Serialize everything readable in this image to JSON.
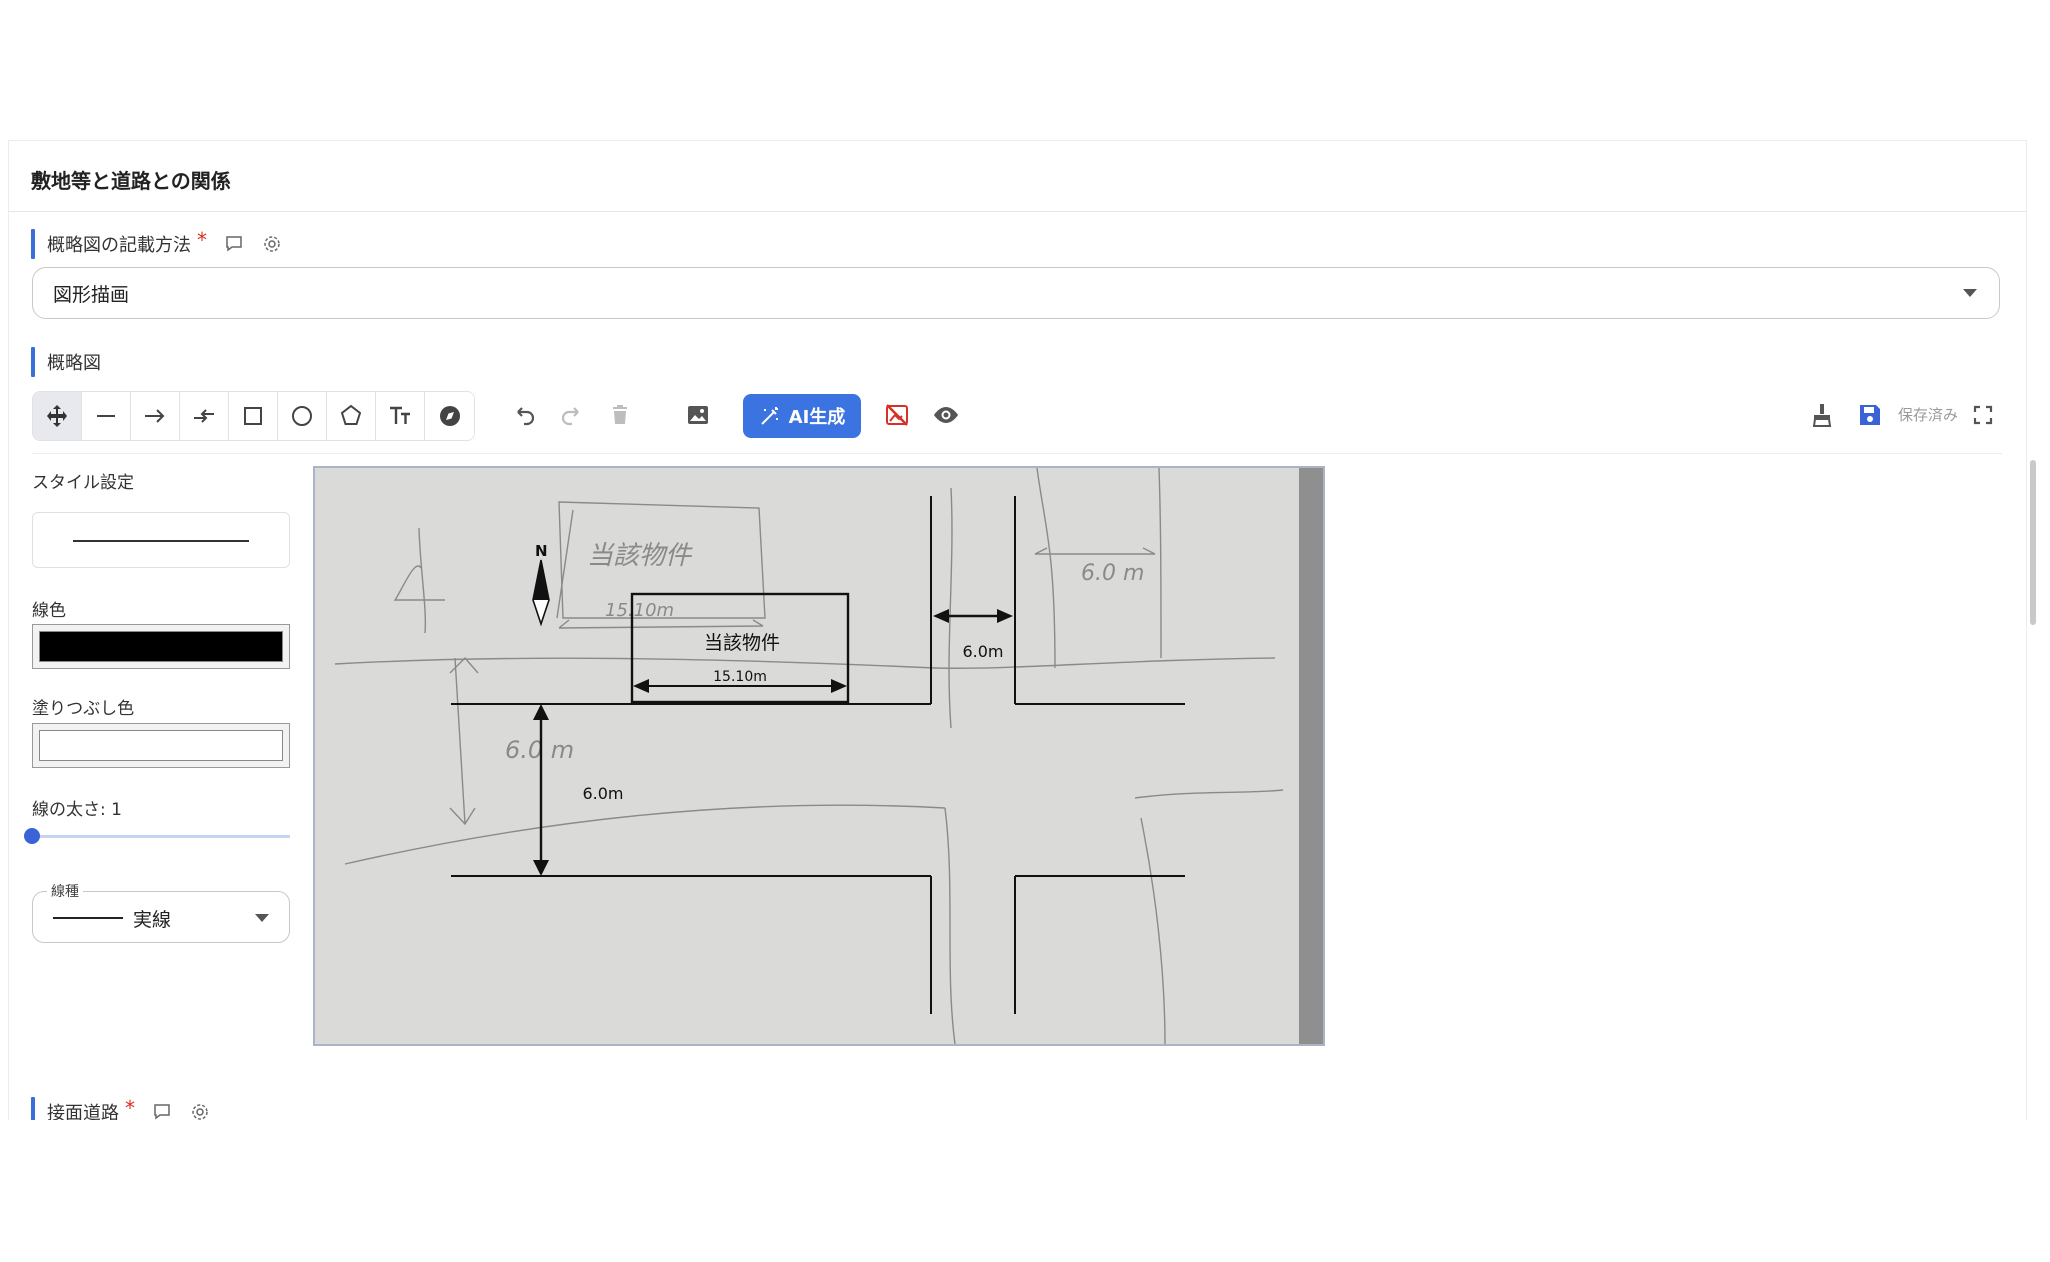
{
  "section": {
    "title": "敷地等と道路との関係"
  },
  "method_field": {
    "label": "概略図の記載方法",
    "required_mark": "*",
    "value": "図形描画"
  },
  "diagram_field": {
    "label": "概略図"
  },
  "toolbar": {
    "tools": [
      "move-icon",
      "line-icon",
      "arrow-icon",
      "double-arrow-icon",
      "rectangle-icon",
      "circle-icon",
      "polygon-icon",
      "text-icon",
      "compass-icon"
    ],
    "ai_button_label": "AI生成",
    "saved_label": "保存済み"
  },
  "style_panel": {
    "title": "スタイル設定",
    "line_color_label": "線色",
    "line_color": "#000000",
    "fill_color_label": "塗りつぶし色",
    "fill_color": "#ffffff",
    "line_width_label": "線の太さ: 1",
    "line_width_value": 1,
    "line_type_label": "線種",
    "line_type_value": "実線"
  },
  "canvas": {
    "handwritten": {
      "property": "当該物件",
      "width": "15.10m",
      "road_right": "6.0 m",
      "road_bottom": "6.0 m"
    },
    "drawn": {
      "north": "N",
      "property": "当該物件",
      "width": "15.10m",
      "road_right": "6.0m",
      "road_bottom": "6.0m"
    }
  },
  "road_field": {
    "label": "接面道路",
    "required_mark": "*"
  },
  "colors": {
    "accent": "#3b73e0",
    "required": "#d93025"
  }
}
